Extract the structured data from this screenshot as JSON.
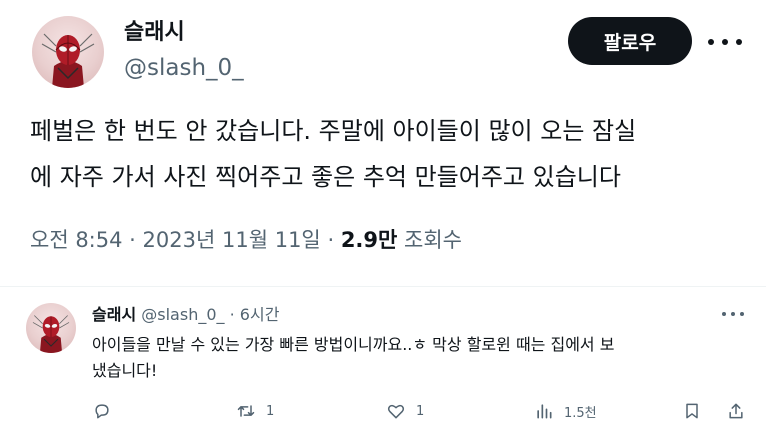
{
  "tweet": {
    "author": {
      "name": "슬래시",
      "handle": "@slash_0_"
    },
    "follow_label": "팔로우",
    "text_line1": "페벌은 한 번도 안 갔습니다. 주말에 아이들이 많이 오는 잠실",
    "text_line2": "에 자주 가서 사진 찍어주고 좋은 추억 만들어주고 있습니다",
    "time": "오전 8:54",
    "date": "2023년 11월 11일",
    "separator": "·",
    "views_count": "2.9만",
    "views_label": "조회수"
  },
  "reply": {
    "name": "슬래시",
    "handle": "@slash_0_",
    "separator": "·",
    "age": "6시간",
    "text_line1": "아이들을 만날 수 있는 가장 빠른 방법이니까요..ㅎ 막상 할로윈 때는 집에서 보",
    "text_line2": "냈습니다!",
    "actions": {
      "replies": "",
      "retweets": "1",
      "likes": "1",
      "views": "1.5천"
    }
  },
  "icons": {
    "more": "more-icon",
    "reply": "reply-icon",
    "retweet": "retweet-icon",
    "like": "heart-icon",
    "views": "bar-chart-icon",
    "bookmark": "bookmark-icon",
    "share": "share-icon"
  },
  "colors": {
    "text_primary": "#0f1419",
    "text_secondary": "#536471",
    "follow_bg": "#0f1419",
    "divider": "#eff3f4"
  }
}
